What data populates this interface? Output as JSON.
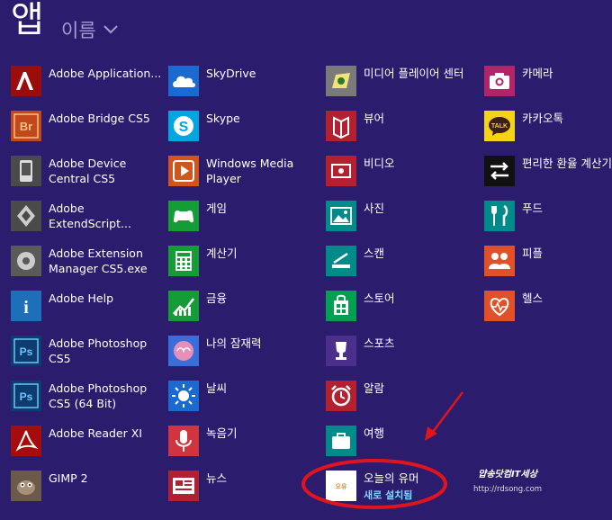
{
  "header": {
    "title": "앱",
    "sort_label": "이름"
  },
  "columns": [
    [
      {
        "label": "Adobe Application...",
        "icon": "adobe-icon",
        "color": "#9b0c0c"
      },
      {
        "label": "Adobe Bridge CS5",
        "icon": "bridge-icon",
        "color": "#c2471b"
      },
      {
        "label": "Adobe Device Central CS5",
        "icon": "device-central-icon",
        "color": "#4a4a4a"
      },
      {
        "label": "Adobe ExtendScript...",
        "icon": "extendscript-icon",
        "color": "#4a4a4a"
      },
      {
        "label": "Adobe Extension Manager CS5.exe",
        "icon": "extension-manager-icon",
        "color": "#5a5a5a"
      },
      {
        "label": "Adobe Help",
        "icon": "help-icon",
        "color": "#1c6fb8"
      },
      {
        "label": "Adobe Photoshop CS5",
        "icon": "photoshop-icon",
        "color": "#0f3c6e"
      },
      {
        "label": "Adobe Photoshop CS5 (64 Bit)",
        "icon": "photoshop-64-icon",
        "color": "#0f3c6e"
      },
      {
        "label": "Adobe Reader XI",
        "icon": "reader-icon",
        "color": "#a70c0c"
      },
      {
        "label": "GIMP 2",
        "icon": "gimp-icon",
        "color": "#6b5a4a"
      }
    ],
    [
      {
        "label": "SkyDrive",
        "icon": "cloud-icon",
        "color": "#1b6ad1"
      },
      {
        "label": "Skype",
        "icon": "skype-icon",
        "color": "#00a6e0"
      },
      {
        "label": "Windows Media Player",
        "icon": "media-player-icon",
        "color": "#d2561c"
      },
      {
        "label": "게임",
        "icon": "game-controller-icon",
        "color": "#149c36"
      },
      {
        "label": "계산기",
        "icon": "calculator-icon",
        "color": "#149c36"
      },
      {
        "label": "금융",
        "icon": "finance-chart-icon",
        "color": "#149c36"
      },
      {
        "label": "나의 잠재력",
        "icon": "brain-icon",
        "color": "#3a6ed8"
      },
      {
        "label": "날씨",
        "icon": "sun-icon",
        "color": "#1b6ad1"
      },
      {
        "label": "녹음기",
        "icon": "microphone-icon",
        "color": "#d1343f"
      },
      {
        "label": "뉴스",
        "icon": "news-icon",
        "color": "#b32032"
      }
    ],
    [
      {
        "label": "미디어 플레이어 센터",
        "icon": "media-center-icon",
        "color": "#7a7a7a"
      },
      {
        "label": "뷰어",
        "icon": "reader-app-icon",
        "color": "#b3202f"
      },
      {
        "label": "비디오",
        "icon": "video-icon",
        "color": "#b3202f"
      },
      {
        "label": "사진",
        "icon": "photo-icon",
        "color": "#008b8b"
      },
      {
        "label": "스캔",
        "icon": "scanner-icon",
        "color": "#008b8b"
      },
      {
        "label": "스토어",
        "icon": "store-icon",
        "color": "#00a050"
      },
      {
        "label": "스포츠",
        "icon": "trophy-icon",
        "color": "#4b2f8c"
      },
      {
        "label": "알람",
        "icon": "alarm-clock-icon",
        "color": "#b3202f"
      },
      {
        "label": "여행",
        "icon": "suitcase-icon",
        "color": "#008b8b"
      },
      {
        "label": "오늘의 유머",
        "icon": "todayhumor-icon",
        "color": "#ffffff",
        "badge": "새로 설치됨"
      }
    ],
    [
      {
        "label": "카메라",
        "icon": "camera-icon",
        "color": "#b02569"
      },
      {
        "label": "카카오톡",
        "icon": "kakaotalk-icon",
        "color": "#f5d317"
      },
      {
        "label": "편리한 환율 계산기",
        "icon": "exchange-arrows-icon",
        "color": "#111111"
      },
      {
        "label": "푸드",
        "icon": "food-utensils-icon",
        "color": "#008b8b"
      },
      {
        "label": "피플",
        "icon": "people-icon",
        "color": "#e0512a"
      },
      {
        "label": "헬스",
        "icon": "health-heart-icon",
        "color": "#e0512a"
      }
    ]
  ],
  "watermark": {
    "line1": "얍송닷컴IT세상",
    "line2": "http://rdsong.com"
  }
}
